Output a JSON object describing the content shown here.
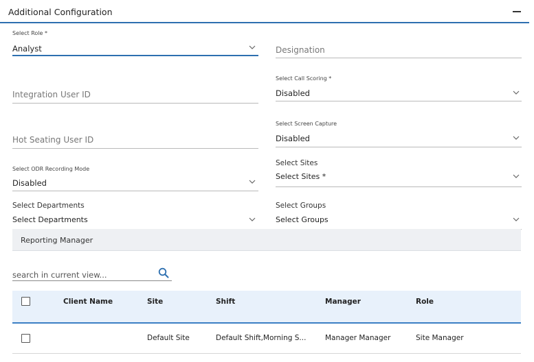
{
  "panel": {
    "title": "Additional Configuration"
  },
  "form": {
    "role": {
      "label": "Select Role *",
      "value": "Analyst"
    },
    "designation": {
      "placeholder": "Designation"
    },
    "integration_user_id": {
      "placeholder": "Integration User ID"
    },
    "call_scoring": {
      "label": "Select Call Scoring *",
      "value": "Disabled"
    },
    "hot_seating_user_id": {
      "placeholder": "Hot Seating User ID"
    },
    "screen_capture": {
      "label": "Select Screen Capture",
      "value": "Disabled"
    },
    "odr_recording_mode": {
      "label": "Select ODR Recording Mode",
      "value": "Disabled"
    },
    "sites": {
      "label": "Select Sites",
      "value": "Select Sites *"
    },
    "departments": {
      "label": "Select Departments",
      "value": "Select Departments"
    },
    "groups": {
      "label": "Select Groups",
      "value": "Select Groups"
    }
  },
  "reporting_manager": {
    "title": "Reporting Manager",
    "search": {
      "placeholder": "search in current view..."
    },
    "columns": [
      "Client Name",
      "Site",
      "Shift",
      "Manager",
      "Role"
    ],
    "rows": [
      {
        "client_name": "",
        "site": "Default Site",
        "shift": "Default Shift,Morning S...",
        "manager": "Manager Manager",
        "role": "Site Manager"
      }
    ]
  },
  "colors": {
    "accent": "#2d6fb0",
    "table_header_bg": "#e8f1fb",
    "section_bar_bg": "#eef0f3"
  },
  "icons": {
    "collapse": "minus-icon",
    "dropdown": "chevron-down-icon",
    "search": "search-icon"
  }
}
